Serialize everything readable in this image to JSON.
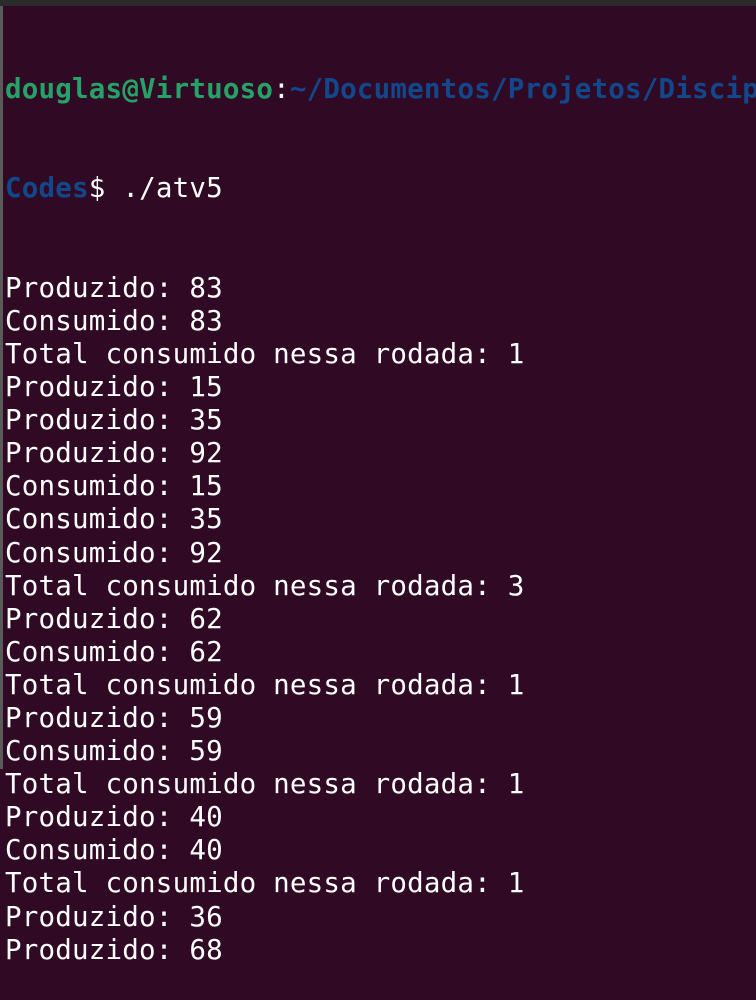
{
  "colors": {
    "background": "#300a24",
    "user_host": "#26a269",
    "path": "#12488b",
    "text": "#ffffff"
  },
  "prompt": {
    "user_host": "douglas@Virtuoso",
    "separator": ":",
    "path_part1": "~/Documentos/Projetos/Discip",
    "path_part2": "Codes",
    "symbol": "$ ",
    "command": "./atv5"
  },
  "output": [
    "Produzido: 83",
    "Consumido: 83",
    "Total consumido nessa rodada: 1",
    "Produzido: 15",
    "Produzido: 35",
    "Produzido: 92",
    "Consumido: 15",
    "Consumido: 35",
    "Consumido: 92",
    "Total consumido nessa rodada: 3",
    "Produzido: 62",
    "Consumido: 62",
    "Total consumido nessa rodada: 1",
    "Produzido: 59",
    "Consumido: 59",
    "Total consumido nessa rodada: 1",
    "Produzido: 40",
    "Consumido: 40",
    "Total consumido nessa rodada: 1",
    "Produzido: 36",
    "Produzido: 68"
  ]
}
